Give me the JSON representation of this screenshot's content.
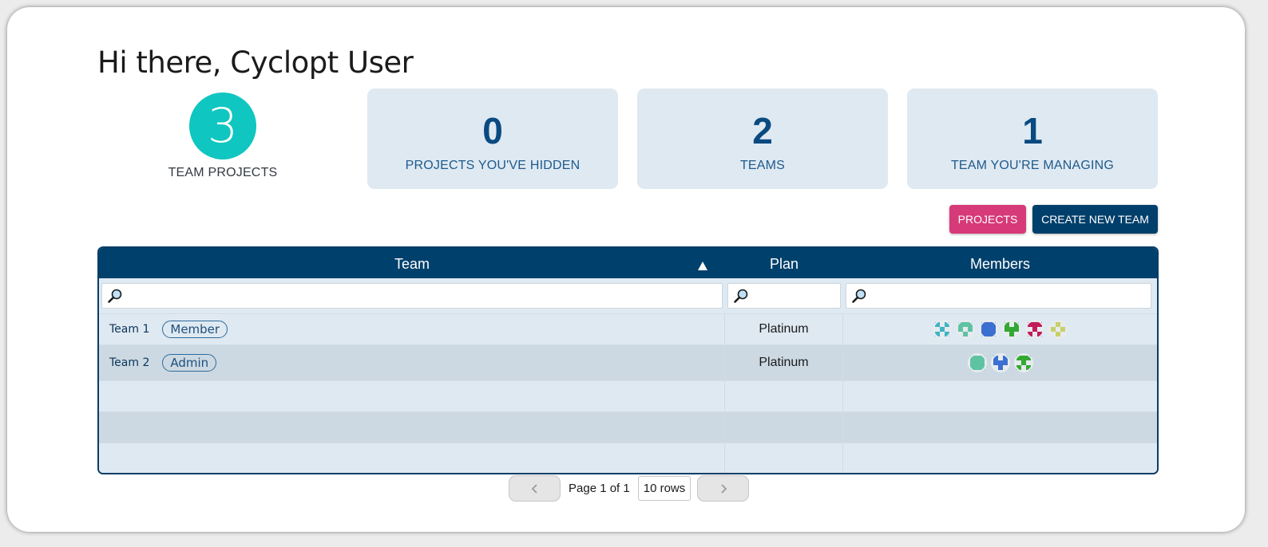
{
  "greeting": "Hi there, Cyclopt User",
  "stats": {
    "team_projects": {
      "value": "3",
      "label": "TEAM PROJECTS"
    },
    "hidden": {
      "value": "0",
      "label": "PROJECTS YOU'VE HIDDEN"
    },
    "teams": {
      "value": "2",
      "label": "TEAMS"
    },
    "managing": {
      "value": "1",
      "label": "TEAM YOU'RE MANAGING"
    }
  },
  "buttons": {
    "projects": "PROJECTS",
    "create_team": "CREATE NEW TEAM"
  },
  "table": {
    "headers": {
      "team": "Team",
      "plan": "Plan",
      "members": "Members"
    },
    "sort": {
      "column": "Team",
      "direction": "ascending"
    },
    "rows": [
      {
        "team": "Team 1",
        "role": "Member",
        "plan": "Platinum",
        "member_avatar_colors": [
          "#3fb3c6",
          "#5ec3a3",
          "#3b6fd1",
          "#33a833",
          "#c21c5a",
          "#c8d06a"
        ]
      },
      {
        "team": "Team 2",
        "role": "Admin",
        "plan": "Platinum",
        "member_avatar_colors": [
          "#5ec3a3",
          "#3b6fd1",
          "#33a833"
        ]
      }
    ]
  },
  "pagination": {
    "prev_icon": "chevron-left-icon",
    "next_icon": "chevron-right-icon",
    "page_text": "Page 1 of 1",
    "rows_text": "10 rows"
  },
  "colors": {
    "accent_teal": "#0fc6c0",
    "primary_navy": "#00406c",
    "projects_pink": "#d63a78",
    "stat_box_bg": "#dfe9f2"
  }
}
